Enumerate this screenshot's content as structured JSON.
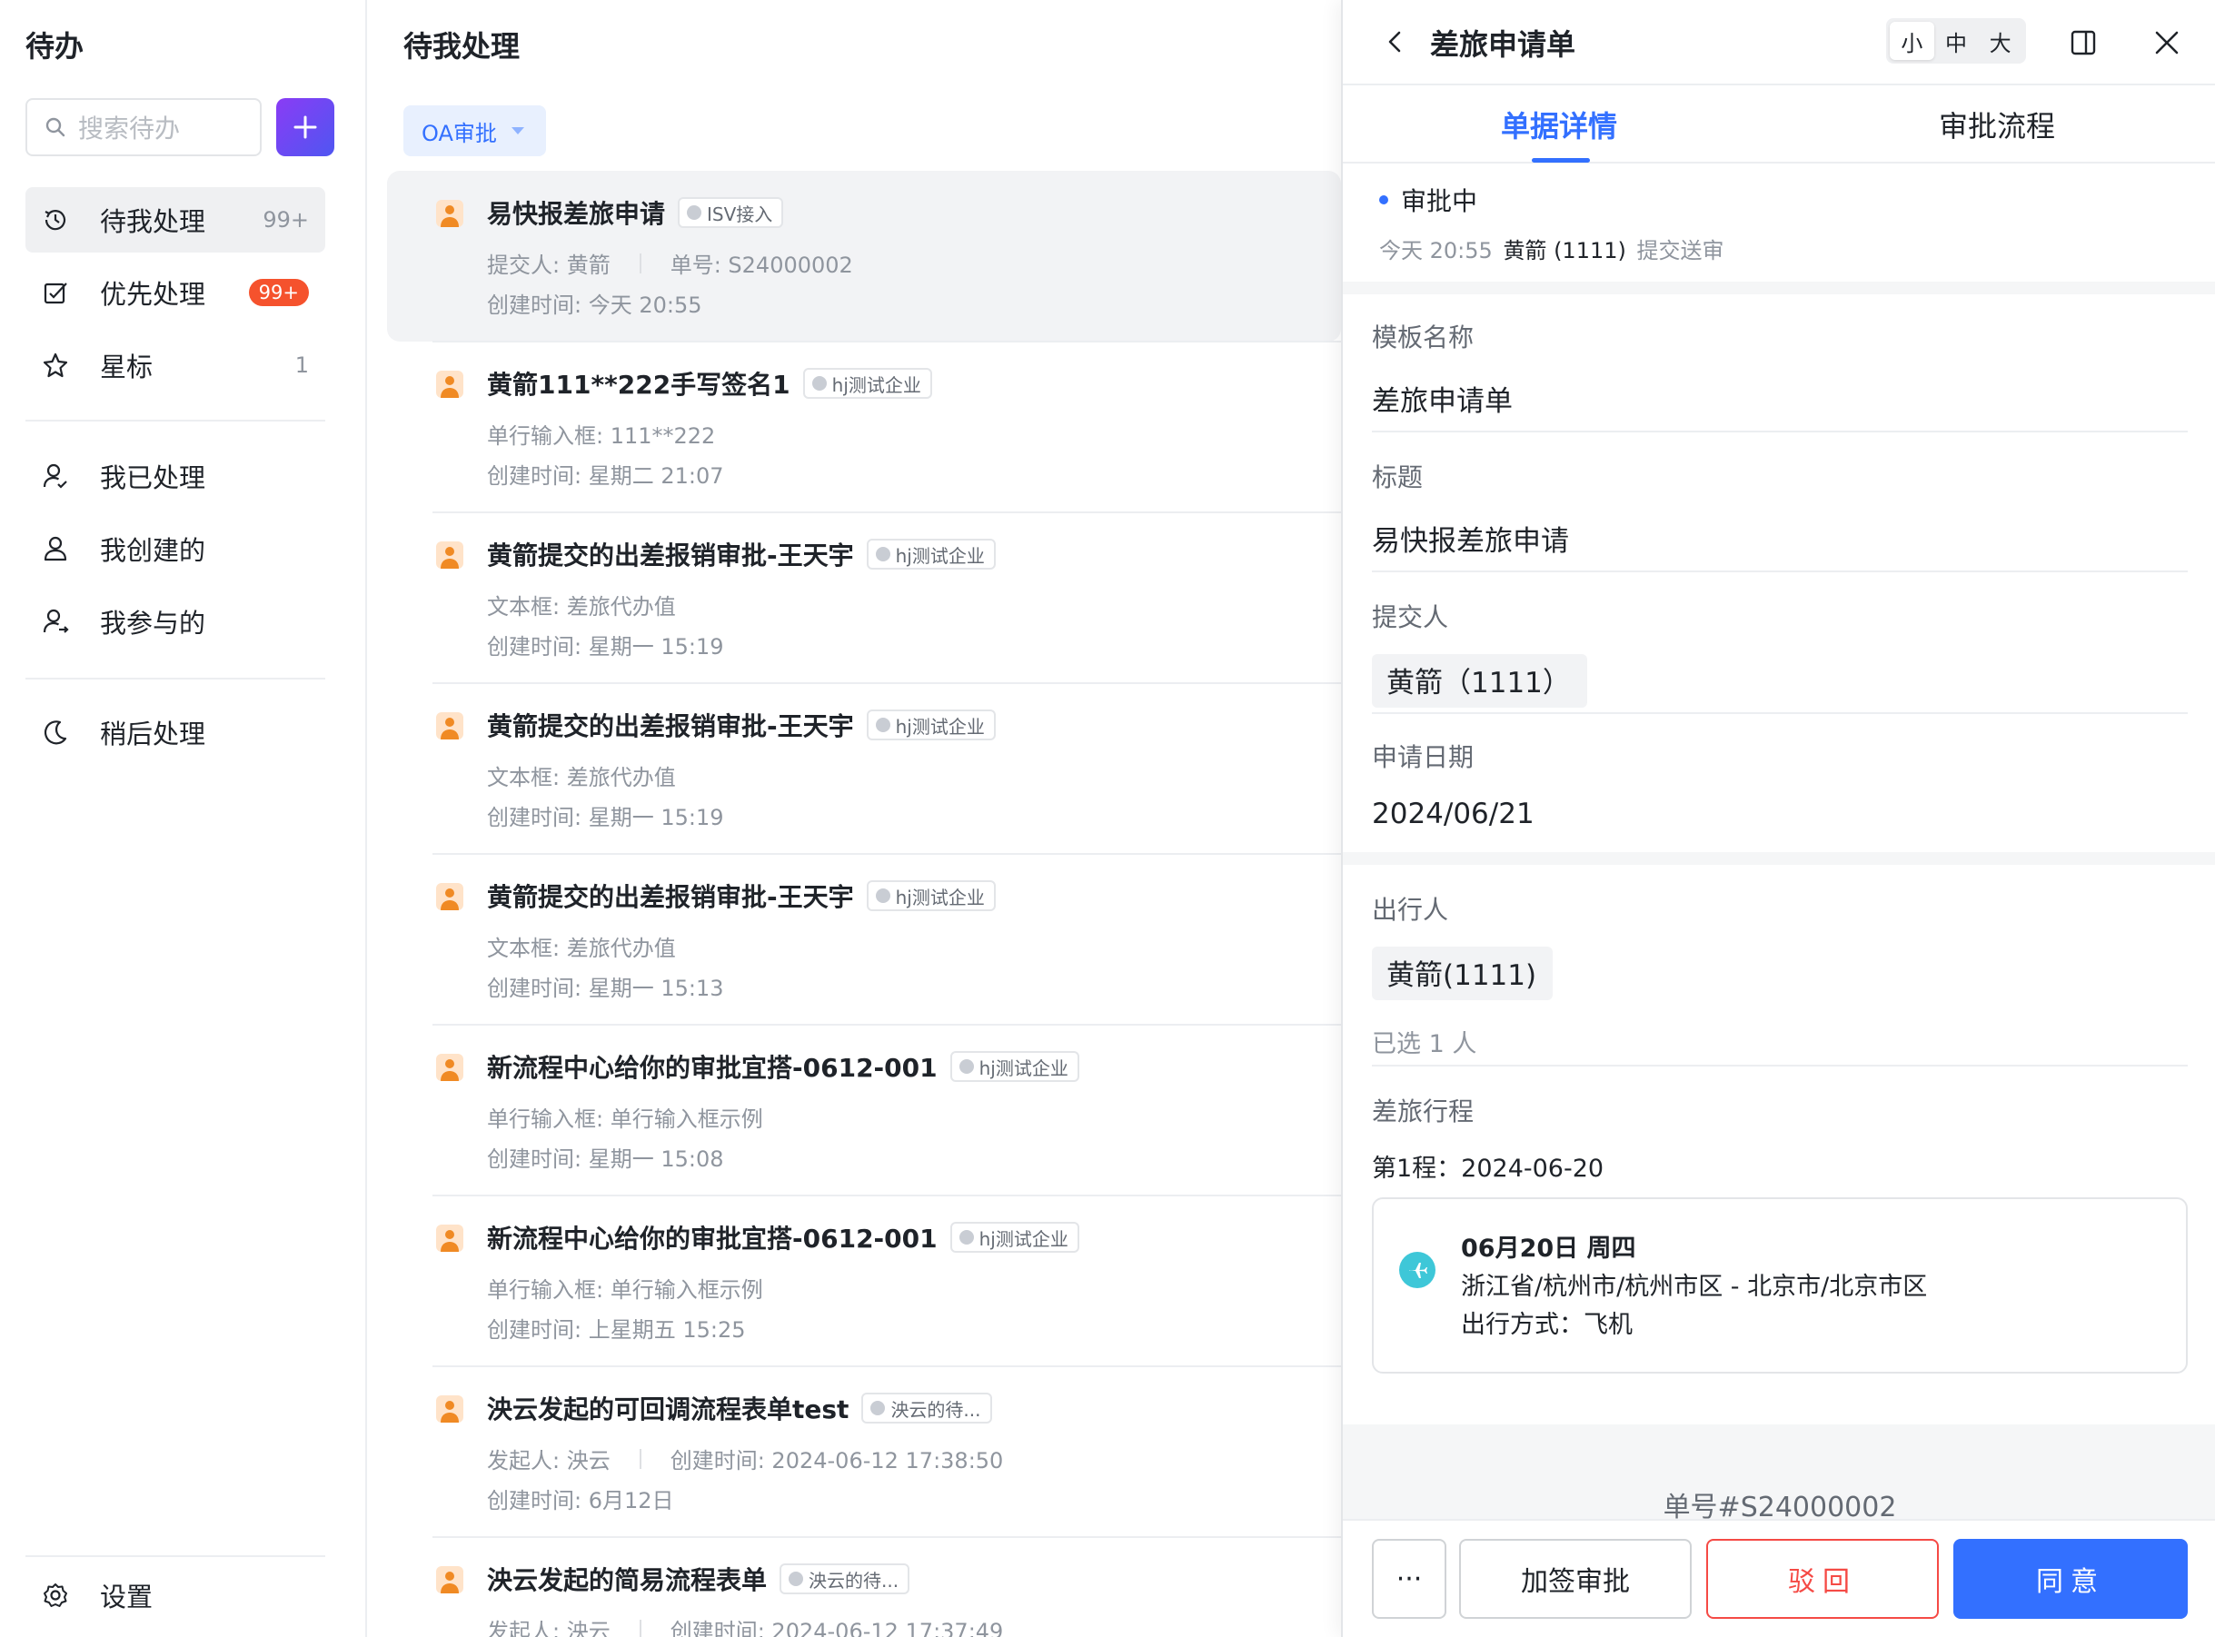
{
  "sidebar": {
    "title": "待办",
    "search_placeholder": "搜索待办",
    "nav": [
      {
        "label": "待我处理",
        "count": "99+"
      },
      {
        "label": "优先处理",
        "badge": "99+"
      },
      {
        "label": "星标",
        "count": "1"
      },
      {
        "label": "我已处理"
      },
      {
        "label": "我创建的"
      },
      {
        "label": "我参与的"
      },
      {
        "label": "稍后处理"
      }
    ],
    "settings_label": "设置"
  },
  "list": {
    "title": "待我处理",
    "filter_label": "OA审批",
    "items": [
      {
        "title": "易快报差旅申请",
        "tag": "ISV接入",
        "line1a": "提交人: 黄箭",
        "line1b": "单号: S24000002",
        "line2": "创建时间: 今天 20:55"
      },
      {
        "title": "黄箭111**222手写签名1",
        "tag": "hj测试企业",
        "line1a": "单行输入框: 111**222",
        "line1b": "",
        "line2": "创建时间: 星期二 21:07"
      },
      {
        "title": "黄箭提交的出差报销审批-王天宇",
        "tag": "hj测试企业",
        "line1a": "文本框: 差旅代办值",
        "line1b": "",
        "line2": "创建时间: 星期一 15:19"
      },
      {
        "title": "黄箭提交的出差报销审批-王天宇",
        "tag": "hj测试企业",
        "line1a": "文本框: 差旅代办值",
        "line1b": "",
        "line2": "创建时间: 星期一 15:19"
      },
      {
        "title": "黄箭提交的出差报销审批-王天宇",
        "tag": "hj测试企业",
        "line1a": "文本框: 差旅代办值",
        "line1b": "",
        "line2": "创建时间: 星期一 15:13"
      },
      {
        "title": "新流程中心给你的审批宜搭-0612-001",
        "tag": "hj测试企业",
        "line1a": "单行输入框: 单行输入框示例",
        "line1b": "",
        "line2": "创建时间: 星期一 15:08"
      },
      {
        "title": "新流程中心给你的审批宜搭-0612-001",
        "tag": "hj测试企业",
        "line1a": "单行输入框: 单行输入框示例",
        "line1b": "",
        "line2": "创建时间: 上星期五 15:25"
      },
      {
        "title": "泱云发起的可回调流程表单test",
        "tag": "泱云的待...",
        "line1a": "发起人: 泱云",
        "line1b": "创建时间: 2024-06-12 17:38:50",
        "line2": "创建时间: 6月12日"
      },
      {
        "title": "泱云发起的简易流程表单",
        "tag": "泱云的待...",
        "line1a": "发起人: 泱云",
        "line1b": "创建时间: 2024-06-12 17:37:49",
        "line2": ""
      }
    ]
  },
  "panel": {
    "title": "差旅申请单",
    "sizes": [
      "小",
      "中",
      "大"
    ],
    "tabs": [
      "单据详情",
      "审批流程"
    ],
    "status": "审批中",
    "submit_time": "今天 20:55",
    "submitter": "黄箭 (1111)",
    "submit_action": "提交送审",
    "fields": {
      "template_label": "模板名称",
      "template_value": "差旅申请单",
      "title_label": "标题",
      "title_value": "易快报差旅申请",
      "submitter_label": "提交人",
      "submitter_value": "黄箭（1111）",
      "date_label": "申请日期",
      "date_value": "2024/06/21",
      "traveler_label": "出行人",
      "traveler_value": "黄箭(1111)",
      "traveler_count": "已选 1 人",
      "trip_label": "差旅行程",
      "trip_leg": "第1程：2024-06-20"
    },
    "trip": {
      "date": "06月20日 周四",
      "route": "浙江省/杭州市/杭州市区 - 北京市/北京市区",
      "mode": "出行方式：飞机"
    },
    "doc_no": "单号#S24000002",
    "actions": {
      "more": "···",
      "add_sign": "加签审批",
      "reject": "驳回",
      "agree": "同意"
    }
  },
  "colors": {
    "accent": "#3370ff",
    "danger": "#f54a45",
    "badge": "#f5522d",
    "brand_gradient": "#8a3cf5"
  }
}
